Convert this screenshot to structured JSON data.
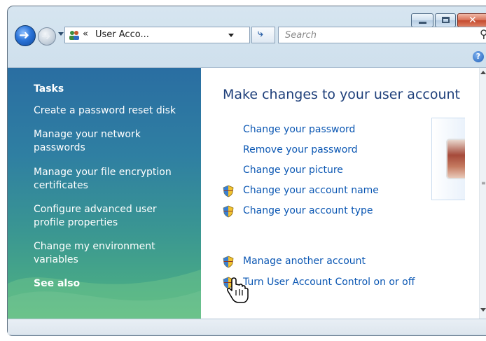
{
  "window": {
    "controls": {
      "minimize": "minimize",
      "maximize": "maximize",
      "close": "✕"
    }
  },
  "address_bar": {
    "chevron": "«",
    "path": "User Acco...",
    "refresh_glyph": "⤷"
  },
  "search": {
    "placeholder": "Search"
  },
  "help": {
    "glyph": "?"
  },
  "tasks": {
    "heading": "Tasks",
    "links": [
      "Create a password reset disk",
      "Manage your network passwords",
      "Manage your file encryption certificates",
      "Configure advanced user profile properties",
      "Change my environment variables"
    ],
    "see_also": "See also"
  },
  "main": {
    "heading": "Make changes to your user account",
    "links": [
      {
        "label": "Change your password",
        "shield": false
      },
      {
        "label": "Remove your password",
        "shield": false
      },
      {
        "label": "Change your picture",
        "shield": false
      },
      {
        "label": "Change your account name",
        "shield": true
      },
      {
        "label": "Change your account type",
        "shield": true
      },
      {
        "label": "Manage another account",
        "shield": true
      },
      {
        "label": "Turn User Account Control on or off",
        "shield": true
      }
    ]
  },
  "colors": {
    "link": "#0b57b3",
    "heading": "#1e3f7a",
    "task_panel_top": "#2a6ea2",
    "task_panel_bottom": "#50b480"
  },
  "icons": [
    "back-arrow-icon",
    "forward-arrow-icon",
    "users-icon",
    "refresh-icon",
    "search-icon",
    "help-icon",
    "shield-icon",
    "hand-cursor-icon"
  ]
}
